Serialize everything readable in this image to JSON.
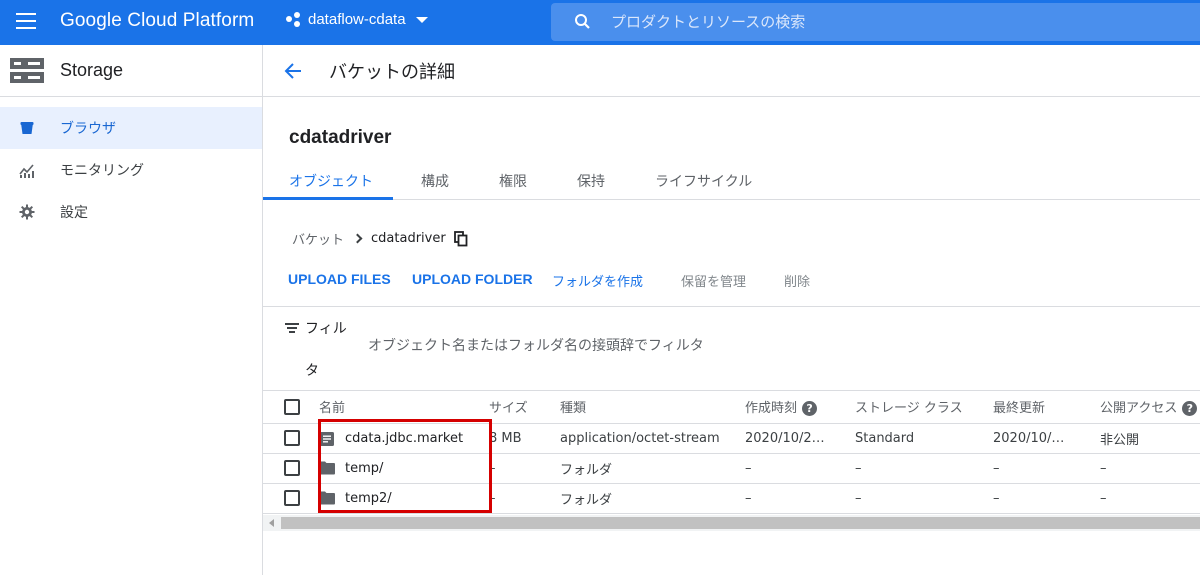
{
  "topbar": {
    "brand": "Google Cloud Platform",
    "project": "dataflow-cdata",
    "search_placeholder": "プロダクトとリソースの検索"
  },
  "sidebar": {
    "title": "Storage",
    "items": [
      {
        "label": "ブラウザ",
        "icon": "bucket-icon",
        "active": true
      },
      {
        "label": "モニタリング",
        "icon": "monitoring-icon",
        "active": false
      },
      {
        "label": "設定",
        "icon": "settings-icon",
        "active": false
      }
    ]
  },
  "page": {
    "title": "バケットの詳細",
    "bucket_name": "cdatadriver"
  },
  "tabs": [
    "オブジェクト",
    "構成",
    "権限",
    "保持",
    "ライフサイクル"
  ],
  "breadcrumb": {
    "root": "バケット",
    "current": "cdatadriver"
  },
  "actions": {
    "upload_files": "UPLOAD FILES",
    "upload_folder": "UPLOAD FOLDER",
    "create_folder": "フォルダを作成",
    "manage_holds": "保留を管理",
    "delete": "削除"
  },
  "filter": {
    "label_line1": "フィル",
    "label_line2": "タ",
    "placeholder": "オブジェクト名またはフォルダ名の接頭辞でフィルタ"
  },
  "table": {
    "columns": [
      "名前",
      "サイズ",
      "種類",
      "作成時刻",
      "ストレージ クラス",
      "最終更新",
      "公開アクセス"
    ],
    "rows": [
      {
        "name": "cdata.jdbc.market",
        "icon": "file-icon",
        "size": "8 MB",
        "type": "application/octet-stream",
        "created": "2020/10/2…",
        "storage_class": "Standard",
        "updated": "2020/10/…",
        "access": "非公開"
      },
      {
        "name": "temp/",
        "icon": "folder-icon",
        "size": "–",
        "type": "フォルダ",
        "created": "–",
        "storage_class": "–",
        "updated": "–",
        "access": "–"
      },
      {
        "name": "temp2/",
        "icon": "folder-icon",
        "size": "–",
        "type": "フォルダ",
        "created": "–",
        "storage_class": "–",
        "updated": "–",
        "access": "–"
      }
    ]
  },
  "colors": {
    "topbar": "#1a73e8",
    "accent": "#1a73e8",
    "highlight_box": "#d50000",
    "active_item_bg": "#e8f0fe"
  }
}
